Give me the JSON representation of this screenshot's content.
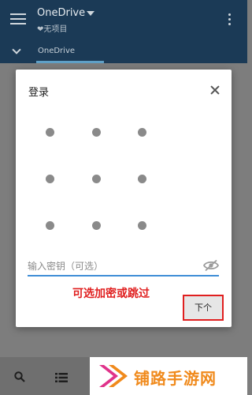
{
  "app_bar": {
    "title": "OneDrive",
    "subtitle": "❤无项目"
  },
  "breadcrumb": {
    "current_tab": "OneDrive"
  },
  "dialog": {
    "title": "登录",
    "pattern_dots": 9,
    "password_placeholder": "输入密钥（可选）",
    "next_label": "下个"
  },
  "annotation": {
    "text": "可选加密或跳过",
    "color": "#e01f1f"
  },
  "watermark": {
    "text": "铺路手游网"
  },
  "colors": {
    "app_bar": "#1b3a56",
    "accent": "#3f8ed6",
    "highlight_border": "#e01f1f",
    "watermark": "#f08a1c"
  }
}
